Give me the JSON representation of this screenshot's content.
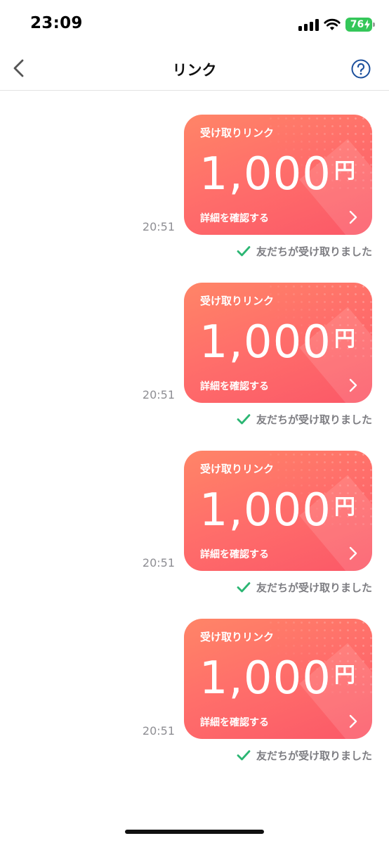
{
  "status_bar": {
    "time": "23:09",
    "battery": "76",
    "signal_icon": "cellular-signal-icon",
    "wifi_icon": "wifi-icon",
    "battery_color": "#34c759"
  },
  "nav": {
    "title": "リンク",
    "back_icon": "chevron-left-icon",
    "help_icon": "question-circle-icon",
    "help_color": "#1b4f9c"
  },
  "messages": [
    {
      "time": "20:51",
      "card_label": "受け取りリンク",
      "amount": "1,000",
      "unit": "円",
      "detail_label": "詳細を確認する",
      "status": "友だちが受け取りました"
    },
    {
      "time": "20:51",
      "card_label": "受け取りリンク",
      "amount": "1,000",
      "unit": "円",
      "detail_label": "詳細を確認する",
      "status": "友だちが受け取りました"
    },
    {
      "time": "20:51",
      "card_label": "受け取りリンク",
      "amount": "1,000",
      "unit": "円",
      "detail_label": "詳細を確認する",
      "status": "友だちが受け取りました"
    },
    {
      "time": "20:51",
      "card_label": "受け取りリンク",
      "amount": "1,000",
      "unit": "円",
      "detail_label": "詳細を確認する",
      "status": "友だちが受け取りました"
    }
  ],
  "colors": {
    "card_gradient_start": "#ff8567",
    "card_gradient_end": "#fb5868",
    "check_color": "#2bb673",
    "muted_text": "#8e8e93"
  }
}
